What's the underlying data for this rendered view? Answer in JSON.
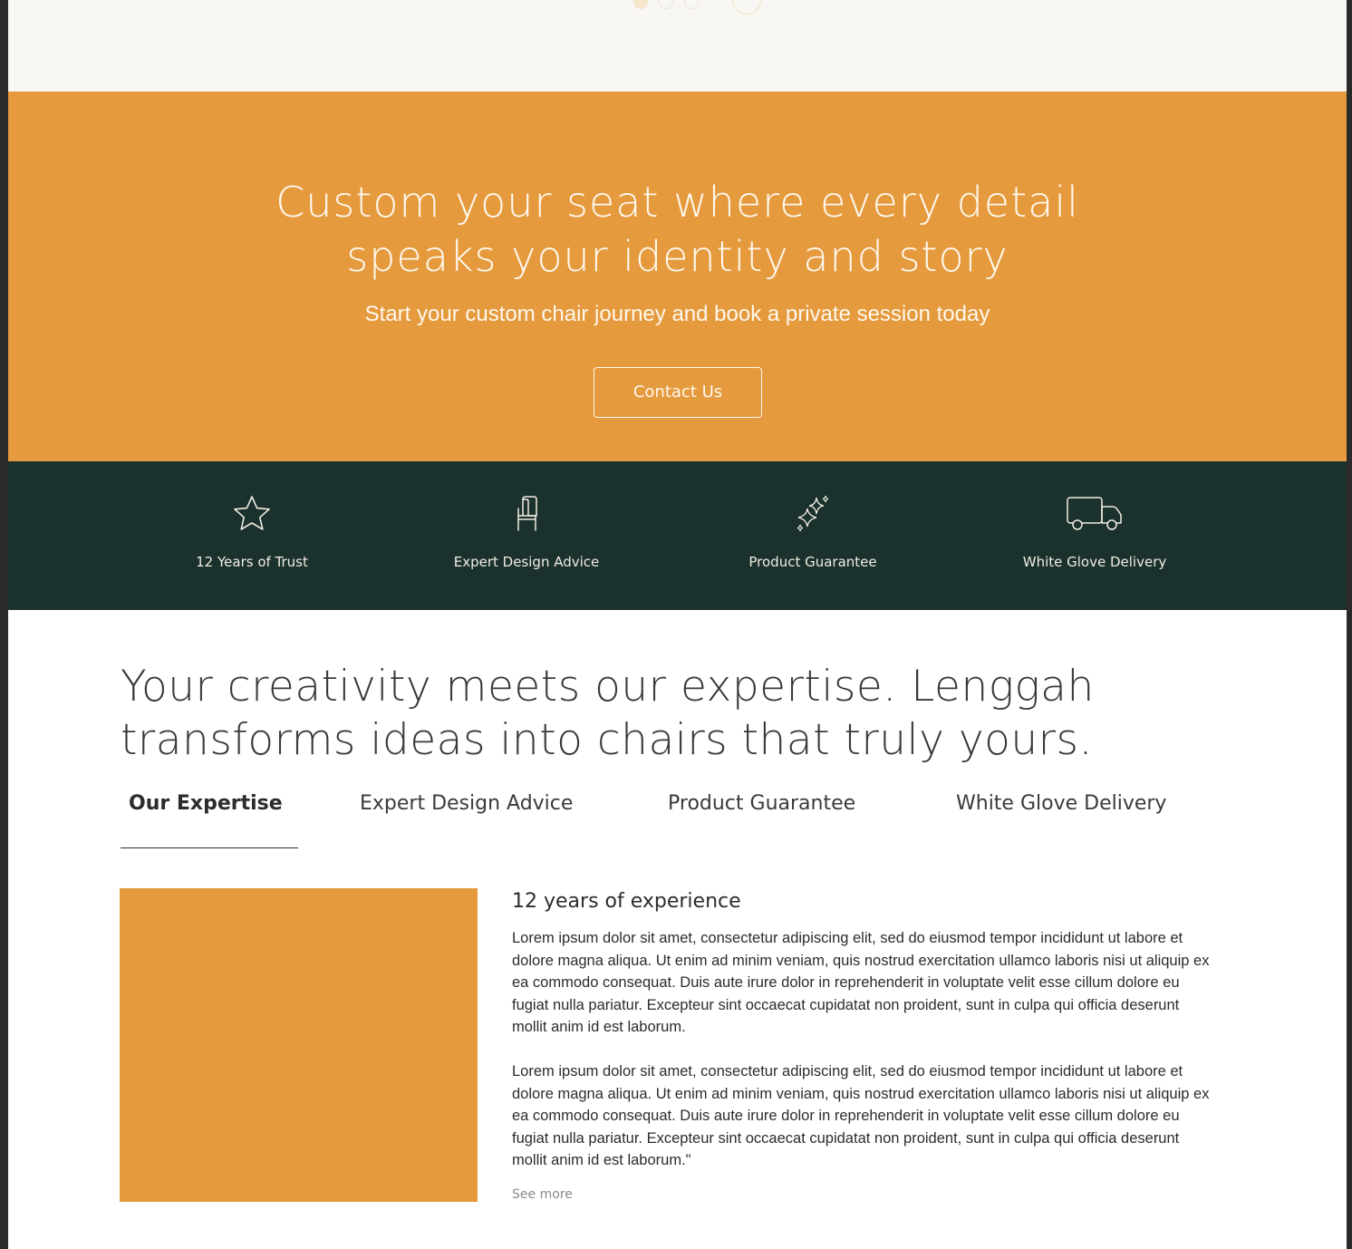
{
  "carousel": {
    "dots": [
      true,
      false,
      false
    ],
    "next_icon": "arrow-next-icon"
  },
  "cta": {
    "title_line1": "Custom your seat where every detail",
    "title_line2": "speaks your identity and story",
    "subtitle": "Start your custom chair journey and book a private session today",
    "button_label": "Contact Us",
    "background_color": "#e59a3d"
  },
  "features": {
    "background_color": "#1a312d",
    "items": [
      {
        "icon": "star-icon",
        "label": "12 Years of Trust"
      },
      {
        "icon": "chair-icon",
        "label": "Expert Design Advice"
      },
      {
        "icon": "sparkle-icon",
        "label": "Product Guarantee"
      },
      {
        "icon": "truck-icon",
        "label": "White Glove Delivery"
      }
    ]
  },
  "about": {
    "heading_line1": "Your creativity meets our expertise. Lenggah",
    "heading_line2": "transforms ideas into chairs that truly yours.",
    "tabs": [
      {
        "label": "Our Expertise",
        "active": true
      },
      {
        "label": "Expert Design Advice",
        "active": false
      },
      {
        "label": "Product Guarantee",
        "active": false
      },
      {
        "label": "White Glove Delivery",
        "active": false
      }
    ],
    "content": {
      "title": "12 years of experience",
      "paragraph1": "Lorem ipsum dolor sit amet, consectetur adipiscing elit, sed do eiusmod tempor incididunt ut labore et dolore magna aliqua. Ut enim ad minim veniam, quis nostrud exercitation ullamco laboris nisi ut aliquip ex ea commodo consequat. Duis aute irure dolor in reprehenderit in voluptate velit esse cillum dolore eu fugiat nulla pariatur. Excepteur sint occaecat cupidatat non proident, sunt in culpa qui officia deserunt mollit anim id est laborum.",
      "paragraph2": "Lorem ipsum dolor sit amet, consectetur adipiscing elit, sed do eiusmod tempor incididunt ut labore et dolore magna aliqua. Ut enim ad minim veniam, quis nostrud exercitation ullamco laboris nisi ut aliquip ex ea commodo consequat. Duis aute irure dolor in reprehenderit in voluptate velit esse cillum dolore eu fugiat nulla pariatur. Excepteur sint occaecat cupidatat non proident, sunt in culpa qui officia deserunt mollit anim id est laborum.\"",
      "see_more": "See more"
    }
  }
}
